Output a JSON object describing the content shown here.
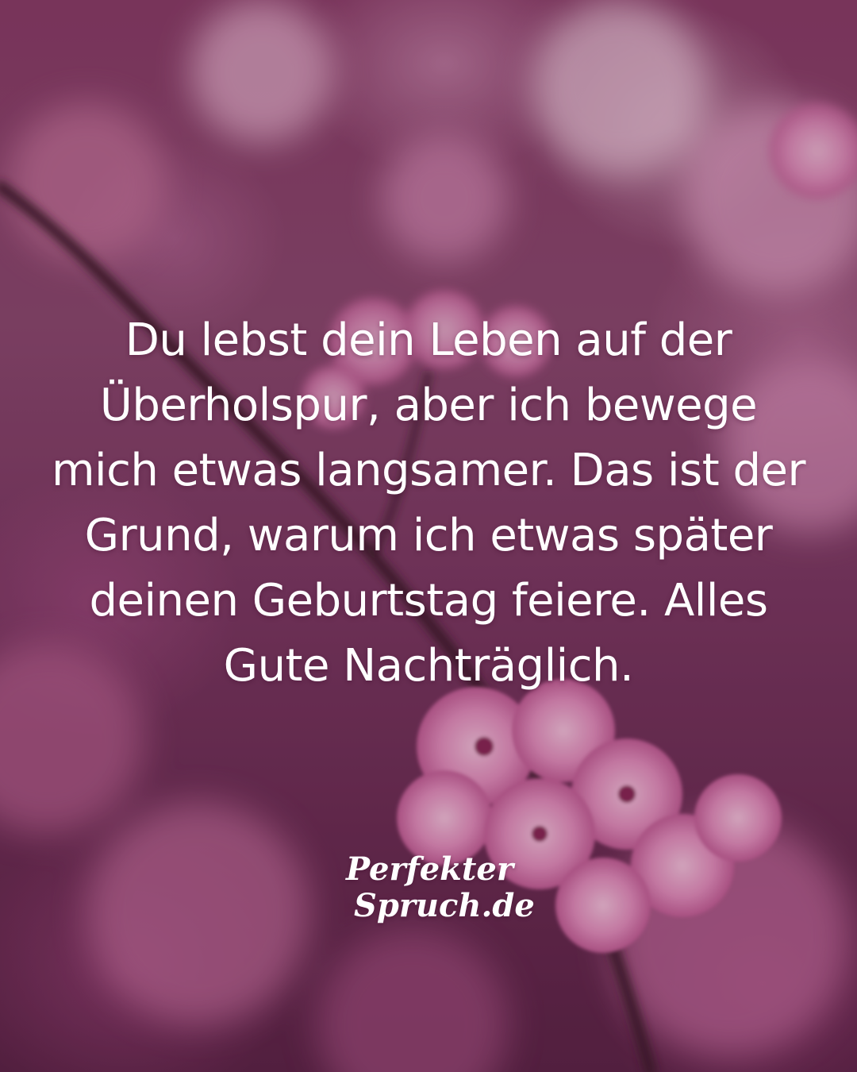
{
  "quote": {
    "lines": [
      "Du lebst dein Leben auf der",
      "Überholspur, aber ich bewege",
      "mich etwas langsamer. Das ist der",
      "Grund, warum ich etwas später",
      "deinen Geburtstag feiere. Alles",
      "Gute Nachträglich."
    ],
    "color": "#ffffff"
  },
  "logo": {
    "line1": "Perfekter",
    "line2": "Spruch.de"
  },
  "background": {
    "subject": "pink cherry blossoms on a dark branch, blurred",
    "accent_color": "#d77aae",
    "base_color": "#7c3963"
  }
}
